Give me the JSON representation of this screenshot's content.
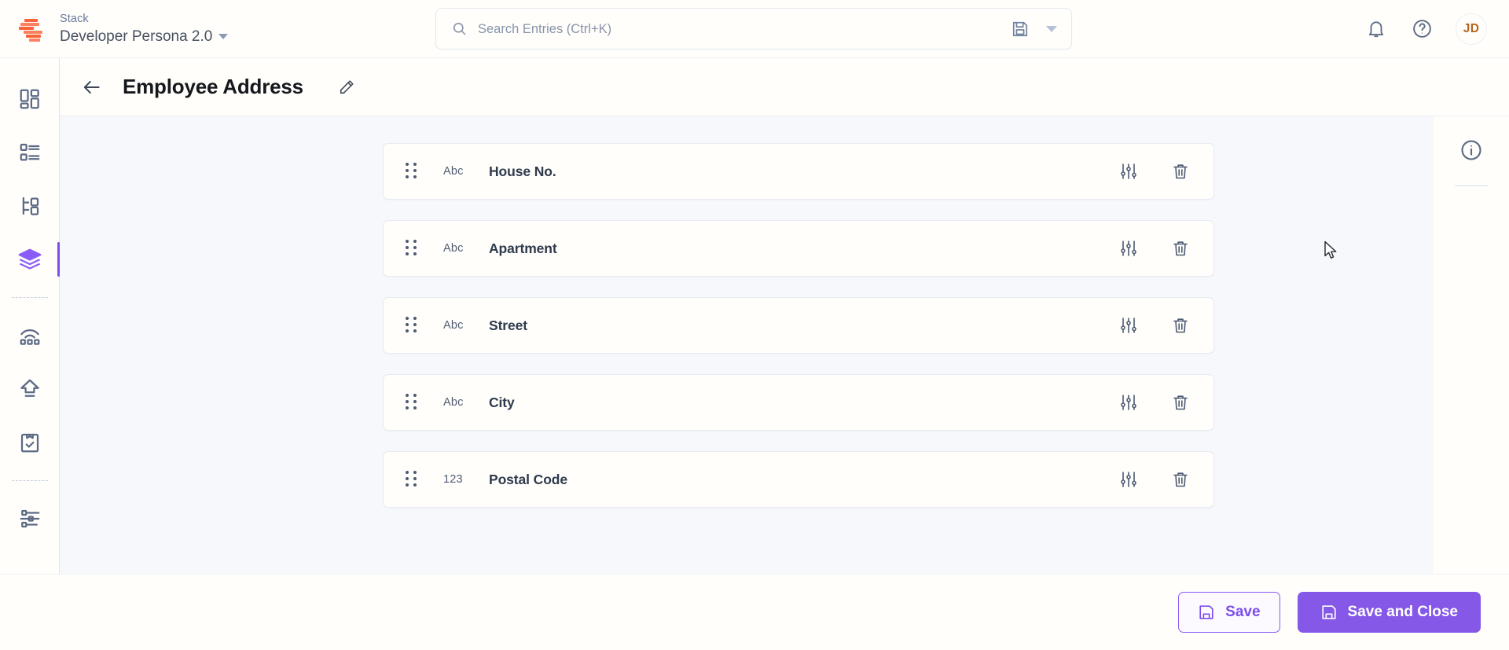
{
  "brand": {
    "logo_name": "contentstack-logo",
    "accent": "#f9633b",
    "primary": "#8558e8"
  },
  "topbar": {
    "stack_label": "Stack",
    "stack_name": "Developer Persona 2.0",
    "search_placeholder": "Search Entries (Ctrl+K)",
    "icons": {
      "search": "search-icon",
      "saved_views": "floppy-disk-icon",
      "dropdown": "chevron-down-icon",
      "notifications": "bell-icon",
      "help": "help-circle-icon"
    },
    "avatar_initials": "JD"
  },
  "sidebar": {
    "items": [
      {
        "name": "dashboard",
        "icon": "dashboard-grid-icon",
        "active": false
      },
      {
        "name": "entries",
        "icon": "list-icon",
        "active": false
      },
      {
        "name": "content-models",
        "icon": "hierarchy-icon",
        "active": false
      },
      {
        "name": "stacks",
        "icon": "layers-icon",
        "active": true
      },
      {
        "name": "publish-queue",
        "icon": "broadcast-icon",
        "active": false
      },
      {
        "name": "releases",
        "icon": "upload-arrow-icon",
        "active": false
      },
      {
        "name": "audit-log",
        "icon": "clipboard-check-icon",
        "active": false
      },
      {
        "name": "settings",
        "icon": "sliders-icon",
        "active": false
      }
    ]
  },
  "page": {
    "back_icon": "arrow-left-icon",
    "title": "Employee Address",
    "edit_icon": "pencil-icon"
  },
  "fields": {
    "row_icons": {
      "drag": "drag-handle-icon",
      "config": "sliders-vertical-icon",
      "delete": "trash-icon"
    },
    "rows": [
      {
        "type": "Abc",
        "name": "House No."
      },
      {
        "type": "Abc",
        "name": "Apartment"
      },
      {
        "type": "Abc",
        "name": "Street"
      },
      {
        "type": "Abc",
        "name": "City"
      },
      {
        "type": "123",
        "name": "Postal Code"
      }
    ]
  },
  "rightpanel": {
    "info_icon": "info-circle-icon"
  },
  "footer": {
    "save_label": "Save",
    "save_close_label": "Save and Close",
    "save_icon": "floppy-disk-icon"
  }
}
